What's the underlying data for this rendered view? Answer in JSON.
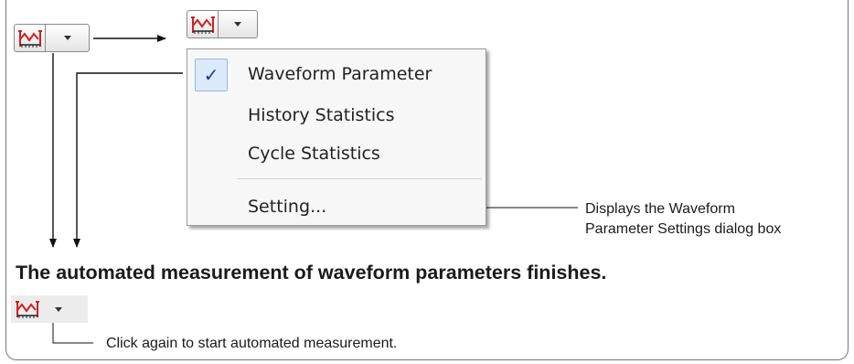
{
  "toolbar_button": {
    "icon": "waveform-parameter-icon",
    "dropdown_icon": "chevron-down-icon"
  },
  "menu": {
    "items": [
      {
        "label": "Waveform Parameter",
        "checked": true
      },
      {
        "label": "History Statistics",
        "checked": false
      },
      {
        "label": "Cycle Statistics",
        "checked": false
      },
      {
        "label": "Setting...",
        "checked": false
      }
    ],
    "check_glyph": "✓"
  },
  "annotations": {
    "setting_note_line1": "Displays the Waveform",
    "setting_note_line2": "Parameter Settings dialog box",
    "finish_heading": "The automated measurement of waveform parameters finishes.",
    "click_again_note": "Click again to start automated measurement."
  },
  "colors": {
    "icon_red": "#cc2222",
    "check_blue": "#1b3d8a",
    "menu_bg": "#f7f7f7"
  }
}
